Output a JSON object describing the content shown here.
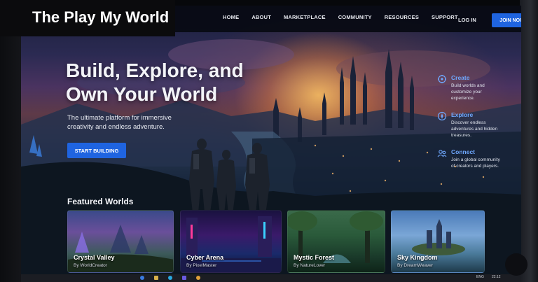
{
  "overlay": {
    "title": "The Play My World"
  },
  "nav": {
    "links": [
      "HOME",
      "ABOUT",
      "MARKETPLACE",
      "COMMUNITY",
      "RESOURCES",
      "SUPPORT"
    ],
    "login": "LOG IN",
    "join": "JOIN NOW"
  },
  "hero": {
    "title_line1": "Build, Explore, and",
    "title_line2": "Own Your World",
    "subtitle": "The ultimate platform for immersive creativity and endless adventure.",
    "cta": "START BUILDING"
  },
  "features": [
    {
      "title": "Create",
      "desc": "Build worlds and customize your experience.",
      "icon": "create-icon"
    },
    {
      "title": "Explore",
      "desc": "Discover endless adventures and hidden treasures.",
      "icon": "compass-icon"
    },
    {
      "title": "Connect",
      "desc": "Join a global community of creators and players.",
      "icon": "people-icon"
    }
  ],
  "featured": {
    "heading": "Featured Worlds",
    "worlds": [
      {
        "name": "Crystal Valley",
        "by": "By WorldCreator"
      },
      {
        "name": "Cyber Arena",
        "by": "By PixelMaster"
      },
      {
        "name": "Mystic Forest",
        "by": "By NatureLover"
      },
      {
        "name": "Sky Kingdom",
        "by": "By DreamWeaver"
      }
    ]
  },
  "taskbar": {
    "lang": "ENG",
    "time": "22:12"
  },
  "colors": {
    "accent": "#1f64e0",
    "feature_title": "#6fa8ff"
  }
}
